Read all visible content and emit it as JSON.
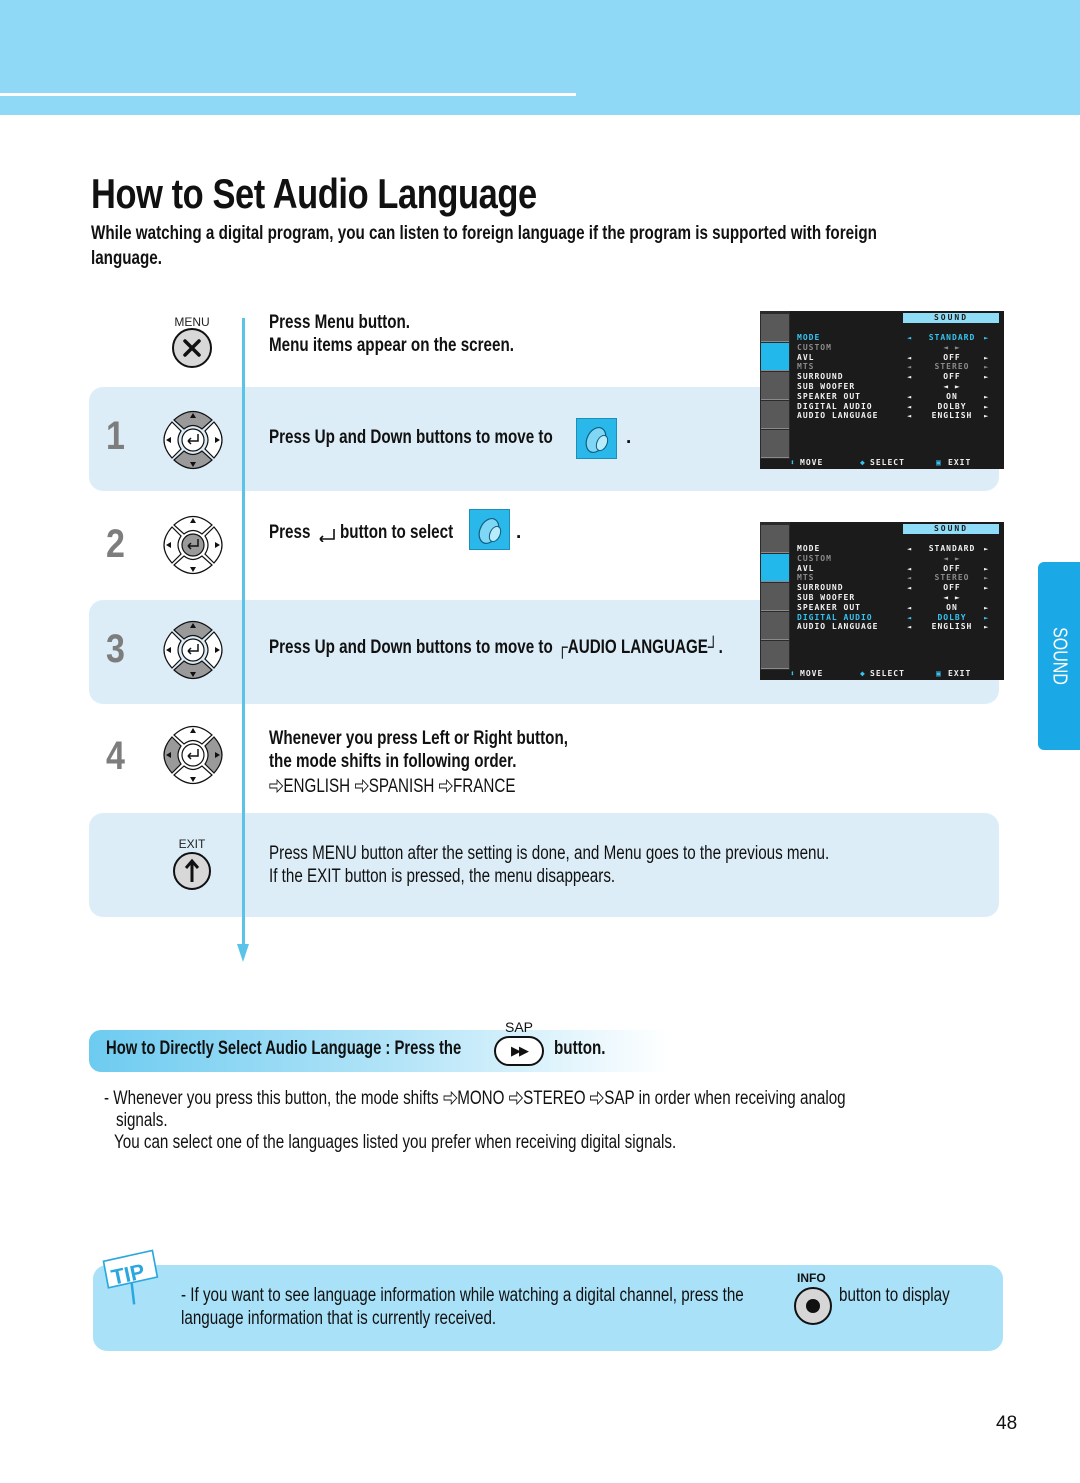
{
  "page": {
    "title": "How to Set Audio Language",
    "intro_line1": "While watching a digital program, you can listen to foreign language if the program is supported with foreign",
    "intro_line2": "language.",
    "page_number": "48",
    "side_tab": "SOUND"
  },
  "steps": {
    "menu": {
      "button_label": "MENU",
      "line1": "Press Menu button.",
      "line2": "Menu items appear on the screen."
    },
    "step1": {
      "number": "1",
      "text": "Press Up and Down buttons to move to",
      "suffix": "."
    },
    "step2": {
      "number": "2",
      "text_before": "Press",
      "text_after": "button to select",
      "suffix": "."
    },
    "step3": {
      "number": "3",
      "text": "Press Up and Down buttons to move to ┌AUDIO LANGUAGE┘."
    },
    "step4": {
      "number": "4",
      "line1": "Whenever you press Left or Right button,",
      "line2": "the mode shifts in following order.",
      "sequence": [
        "ENGLISH",
        "SPANISH",
        "FRANCE"
      ]
    },
    "exit": {
      "button_label": "EXIT",
      "line1": "Press MENU button after the setting is done, and Menu goes to the previous menu.",
      "line2": "If the EXIT button is pressed, the menu disappears."
    }
  },
  "osd_screens": [
    {
      "title": "SOUND",
      "active_icon": "sound",
      "rows": [
        {
          "label": "MODE",
          "value": "STANDARD",
          "state": "highlight",
          "arrows": true
        },
        {
          "label": "CUSTOM",
          "value": "◄ ►",
          "state": "dim",
          "arrows": false
        },
        {
          "label": "AVL",
          "value": "OFF",
          "state": "normal",
          "arrows": true
        },
        {
          "label": "MTS",
          "value": "STEREO",
          "state": "dim",
          "arrows": true
        },
        {
          "label": "SURROUND",
          "value": "OFF",
          "state": "normal",
          "arrows": true
        },
        {
          "label": "SUB WOOFER",
          "value": "◄ ►",
          "state": "normal",
          "arrows": false
        },
        {
          "label": "SPEAKER OUT",
          "value": "ON",
          "state": "normal",
          "arrows": true
        },
        {
          "label": "DIGITAL AUDIO",
          "value": "DOLBY",
          "state": "normal",
          "arrows": true
        },
        {
          "label": "AUDIO LANGUAGE",
          "value": "ENGLISH",
          "state": "normal",
          "arrows": true
        }
      ],
      "footer": {
        "move": "MOVE",
        "select": "SELECT",
        "exit": "EXIT"
      }
    },
    {
      "title": "SOUND",
      "active_icon": "sound",
      "rows": [
        {
          "label": "MODE",
          "value": "STANDARD",
          "state": "normal",
          "arrows": true
        },
        {
          "label": "CUSTOM",
          "value": "◄ ►",
          "state": "dim",
          "arrows": false
        },
        {
          "label": "AVL",
          "value": "OFF",
          "state": "normal",
          "arrows": true
        },
        {
          "label": "MTS",
          "value": "STEREO",
          "state": "dim",
          "arrows": true
        },
        {
          "label": "SURROUND",
          "value": "OFF",
          "state": "normal",
          "arrows": true
        },
        {
          "label": "SUB WOOFER",
          "value": "◄ ►",
          "state": "normal",
          "arrows": false
        },
        {
          "label": "SPEAKER OUT",
          "value": "ON",
          "state": "normal",
          "arrows": true
        },
        {
          "label": "DIGITAL AUDIO",
          "value": "DOLBY",
          "state": "highlight",
          "arrows": true
        },
        {
          "label": "AUDIO LANGUAGE",
          "value": "ENGLISH",
          "state": "normal",
          "arrows": true
        }
      ],
      "footer": {
        "move": "MOVE",
        "select": "SELECT",
        "exit": "EXIT"
      }
    }
  ],
  "direct": {
    "heading": "How to Directly Select Audio Language : Press the",
    "button_label": "SAP",
    "button_suffix": "button.",
    "note_prefix": "- Whenever you press this button, the mode shifts",
    "sequence": [
      "MONO",
      "STEREO",
      "SAP"
    ],
    "note_suffix": "in order when receiving analog",
    "note_line2": "signals.",
    "note_line3": "You can select one of the languages listed you prefer when receiving digital signals."
  },
  "tip": {
    "sign": "TIP",
    "line1_before": "- If you want to see language information while watching a digital channel, press the",
    "button_label": "INFO",
    "line1_after": "button to display",
    "line2": "language information that is currently received."
  }
}
